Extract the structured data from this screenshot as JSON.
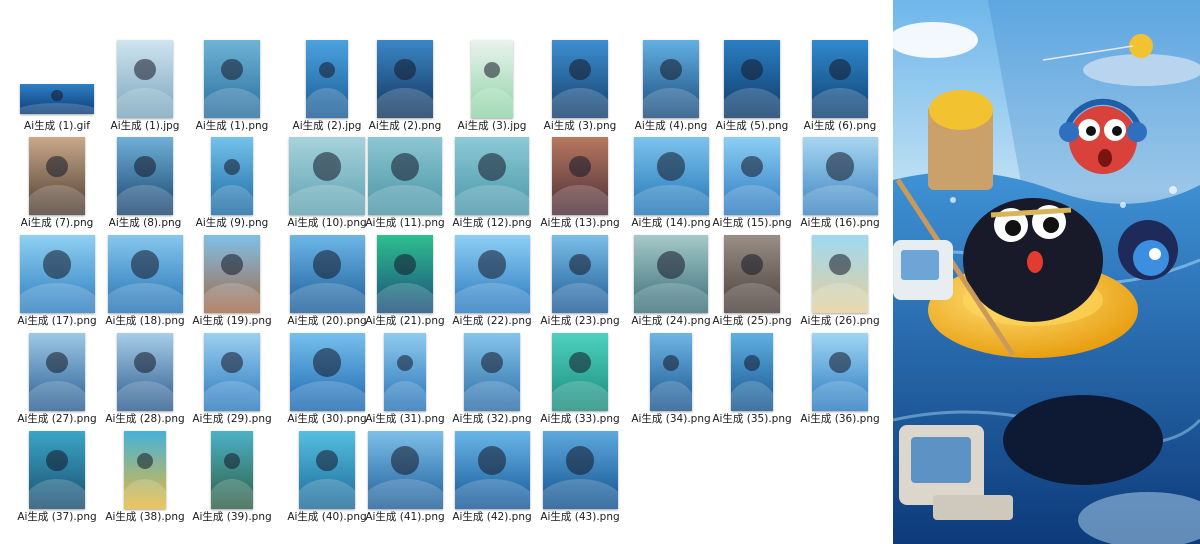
{
  "files": [
    {
      "name": "Ai生成 (1).gif",
      "icon": "animated-gif-thumbnail",
      "colors": [
        "#2f7fc4",
        "#0d3d78"
      ]
    },
    {
      "name": "Ai生成 (1).jpg",
      "icon": "retro-computer-thumbnail",
      "colors": [
        "#cfe4ef",
        "#7aa6bd"
      ]
    },
    {
      "name": "Ai生成 (1).png",
      "icon": "collage-thumbnail",
      "colors": [
        "#6fb3d6",
        "#2a6f9e"
      ]
    },
    {
      "name": "Ai生成 (2).jpg",
      "icon": "sea-creature-thumbnail",
      "colors": [
        "#4aa3df",
        "#1b5c95"
      ]
    },
    {
      "name": "Ai生成 (2).png",
      "icon": "collage-thumbnail",
      "colors": [
        "#3b86c6",
        "#14365e"
      ]
    },
    {
      "name": "Ai生成 (3).jpg",
      "icon": "island-thumbnail",
      "colors": [
        "#eaf3ee",
        "#8fd4a6"
      ]
    },
    {
      "name": "Ai生成 (3).png",
      "icon": "collage-thumbnail",
      "colors": [
        "#3d8fd1",
        "#15406d"
      ]
    },
    {
      "name": "Ai生成 (4).png",
      "icon": "collage-thumbnail",
      "colors": [
        "#63b0e3",
        "#1b4d7e"
      ]
    },
    {
      "name": "Ai生成 (5).png",
      "icon": "collage-thumbnail",
      "colors": [
        "#2b7fc4",
        "#0f3a66"
      ]
    },
    {
      "name": "Ai生成 (6).png",
      "icon": "collage-thumbnail",
      "colors": [
        "#2f8ad0",
        "#10406f"
      ]
    },
    {
      "name": "Ai生成 (7).png",
      "icon": "collage-thumbnail",
      "colors": [
        "#c9a98a",
        "#4e3d33"
      ]
    },
    {
      "name": "Ai生成 (8).png",
      "icon": "collage-thumbnail",
      "colors": [
        "#6fb0d8",
        "#1b4670"
      ]
    },
    {
      "name": "Ai生成 (9).png",
      "icon": "ship-thumbnail",
      "colors": [
        "#74c3ec",
        "#1d6aa3"
      ]
    },
    {
      "name": "Ai生成 (10).png",
      "icon": "fishing-cat-thumbnail",
      "colors": [
        "#a7d3dc",
        "#5fa3b1"
      ]
    },
    {
      "name": "Ai生成 (11).png",
      "icon": "fishing-cat-thumbnail",
      "colors": [
        "#8bc7d2",
        "#4b95a6"
      ]
    },
    {
      "name": "Ai生成 (12).png",
      "icon": "fishing-cat-thumbnail",
      "colors": [
        "#8ccad6",
        "#4a96a8"
      ]
    },
    {
      "name": "Ai生成 (13).png",
      "icon": "castle-thumbnail",
      "colors": [
        "#b8785e",
        "#4b2f3a"
      ]
    },
    {
      "name": "Ai生成 (14).png",
      "icon": "sea-creature-thumbnail",
      "colors": [
        "#7cc3ee",
        "#2476b6"
      ]
    },
    {
      "name": "Ai生成 (15).png",
      "icon": "sea-creature-thumbnail",
      "colors": [
        "#8ccff4",
        "#2e7bc0"
      ]
    },
    {
      "name": "Ai生成 (16).png",
      "icon": "fish-thumbnail",
      "colors": [
        "#a8d6f1",
        "#3d86c3"
      ]
    },
    {
      "name": "Ai生成 (17).png",
      "icon": "fish-thumbnail",
      "colors": [
        "#8fd0f2",
        "#2f7fc0"
      ]
    },
    {
      "name": "Ai生成 (18).png",
      "icon": "fish-thumbnail",
      "colors": [
        "#86c7ee",
        "#2674b5"
      ]
    },
    {
      "name": "Ai生成 (19).png",
      "icon": "ship-thumbnail",
      "colors": [
        "#7fc1e6",
        "#a26a4a"
      ]
    },
    {
      "name": "Ai生成 (20).png",
      "icon": "sea-creature-thumbnail",
      "colors": [
        "#6db7e8",
        "#1d5e98"
      ]
    },
    {
      "name": "Ai生成 (21).png",
      "icon": "island-thumbnail",
      "colors": [
        "#2fbf8f",
        "#1a4f7a"
      ]
    },
    {
      "name": "Ai生成 (22).png",
      "icon": "dolphin-thumbnail",
      "colors": [
        "#8ed0f5",
        "#2a78bf"
      ]
    },
    {
      "name": "Ai生成 (23).png",
      "icon": "sea-creature-thumbnail",
      "colors": [
        "#7bbfe9",
        "#1f5c96"
      ]
    },
    {
      "name": "Ai生成 (24).png",
      "icon": "sea-creature-thumbnail",
      "colors": [
        "#a5c9c7",
        "#3c6f7a"
      ]
    },
    {
      "name": "Ai生成 (25).png",
      "icon": "retro-computer-thumbnail",
      "colors": [
        "#9a8f86",
        "#4a3f3a"
      ]
    },
    {
      "name": "Ai生成 (26).png",
      "icon": "retro-computer-thumbnail",
      "colors": [
        "#9dd9f2",
        "#e6cf9b"
      ]
    },
    {
      "name": "Ai生成 (27).png",
      "icon": "ship-thumbnail",
      "colors": [
        "#9ec9e6",
        "#2a5f93"
      ]
    },
    {
      "name": "Ai生成 (28).png",
      "icon": "ship-thumbnail",
      "colors": [
        "#a7cde8",
        "#2d5d8f"
      ]
    },
    {
      "name": "Ai生成 (29).png",
      "icon": "balloon-thumbnail",
      "colors": [
        "#9bd0f0",
        "#2c7ac0"
      ]
    },
    {
      "name": "Ai生成 (30).png",
      "icon": "balloon-thumbnail",
      "colors": [
        "#76c0ee",
        "#1d68b0"
      ]
    },
    {
      "name": "Ai生成 (31).png",
      "icon": "retro-computer-thumbnail",
      "colors": [
        "#8fcbef",
        "#2773b8"
      ]
    },
    {
      "name": "Ai生成 (32).png",
      "icon": "retro-computer-thumbnail",
      "colors": [
        "#86c5ea",
        "#2c6ea8"
      ]
    },
    {
      "name": "Ai生成 (33).png",
      "icon": "character-thumbnail",
      "colors": [
        "#4fd1c0",
        "#1b8c7c"
      ]
    },
    {
      "name": "Ai生成 (34).png",
      "icon": "sea-creature-thumbnail",
      "colors": [
        "#6fb6e6",
        "#1c568e"
      ]
    },
    {
      "name": "Ai生成 (35).png",
      "icon": "controller-thumbnail",
      "colors": [
        "#5fb0e4",
        "#17568f"
      ]
    },
    {
      "name": "Ai生成 (36).png",
      "icon": "sea-creature-thumbnail",
      "colors": [
        "#9fd6f3",
        "#2b7bc1"
      ]
    },
    {
      "name": "Ai生成 (37).png",
      "icon": "collage-thumbnail",
      "colors": [
        "#3aa6c8",
        "#1b4e6f"
      ]
    },
    {
      "name": "Ai生成 (38).png",
      "icon": "character-thumbnail",
      "colors": [
        "#45b2d8",
        "#e7b93b"
      ]
    },
    {
      "name": "Ai生成 (39).png",
      "icon": "collage-thumbnail",
      "colors": [
        "#4cb2c7",
        "#2f5f45"
      ]
    },
    {
      "name": "Ai生成 (40).png",
      "icon": "character-thumbnail",
      "colors": [
        "#55bfe0",
        "#1e6b9a"
      ]
    },
    {
      "name": "Ai生成 (41).png",
      "icon": "retro-computer-thumbnail",
      "colors": [
        "#7ec0ea",
        "#1f5f9c"
      ]
    },
    {
      "name": "Ai生成 (42).png",
      "icon": "wave-thumbnail",
      "colors": [
        "#69b6e8",
        "#16599a"
      ]
    },
    {
      "name": "Ai生成 (43).png",
      "icon": "wave-thumbnail",
      "colors": [
        "#5ea9de",
        "#13528e"
      ]
    }
  ],
  "preview": {
    "icon": "preview-image-panel",
    "colors": {
      "sky": "#a7d3ee",
      "sea": "#2f7ccb",
      "deep": "#114a8d",
      "float": "#f3c119",
      "creature": "#1b1d2e"
    }
  }
}
